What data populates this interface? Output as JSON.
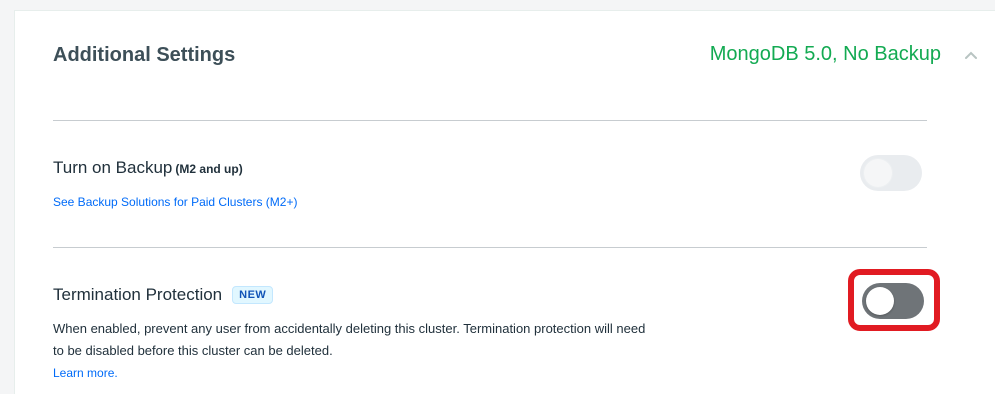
{
  "header": {
    "title": "Additional Settings",
    "summary": "MongoDB 5.0, No Backup",
    "summary_color": "#13aa52",
    "collapse_icon": "chevron-up-icon"
  },
  "backup": {
    "title": "Turn on Backup",
    "note": "(M2 and up)",
    "link": "See Backup Solutions for Paid Clusters (M2+)",
    "toggle_state": "disabled"
  },
  "termination": {
    "title": "Termination Protection",
    "badge": "NEW",
    "description": "When enabled, prevent any user from accidentally deleting this cluster. Termination protection will need to be disabled before this cluster can be deleted.",
    "learn_more": "Learn more.",
    "toggle_state": "off",
    "highlight_color": "#e11b22"
  }
}
